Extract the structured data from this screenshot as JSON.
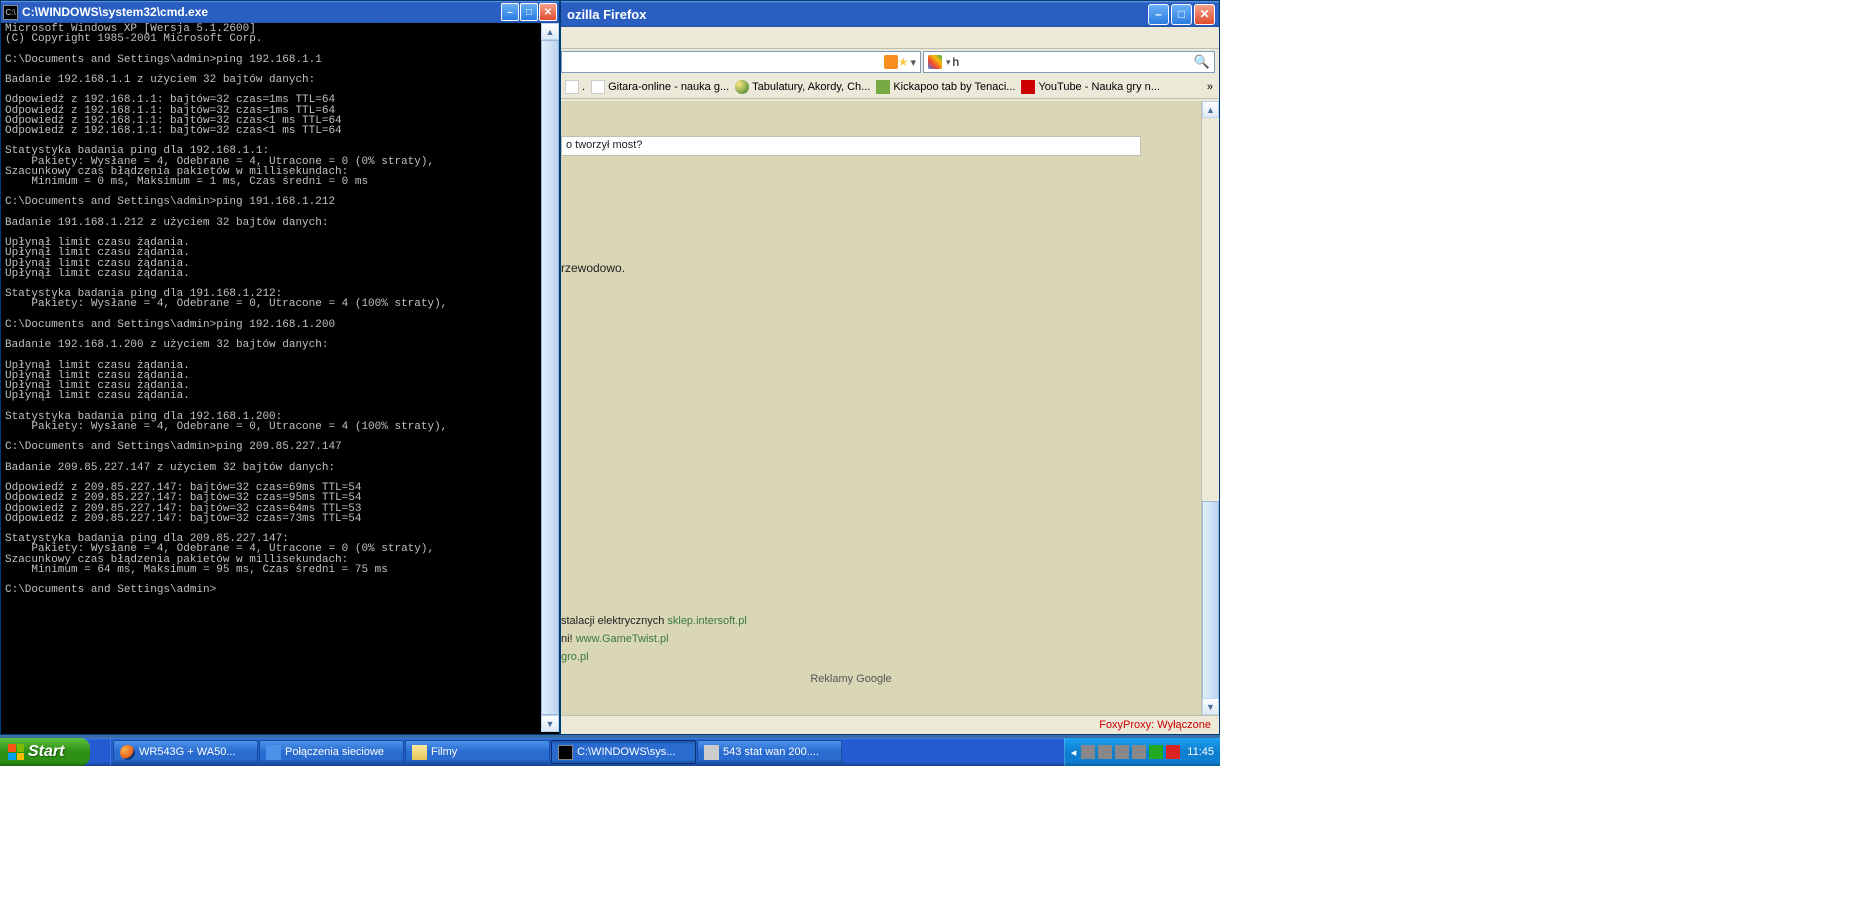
{
  "firefox": {
    "title": "ozilla Firefox",
    "search_value": "h",
    "bookmarks": [
      {
        "label": ".",
        "icon": "page"
      },
      {
        "label": "Gitara-online - nauka g...",
        "icon": "page"
      },
      {
        "label": "Tabulatury, Akordy, Ch...",
        "icon": "ball"
      },
      {
        "label": "Kickapoo tab by Tenaci...",
        "icon": "gt"
      },
      {
        "label": "YouTube - Nauka gry n...",
        "icon": "yt"
      }
    ],
    "page": {
      "question": "o tworzył most?",
      "bodyline": "rzewodowo.",
      "ads": [
        {
          "text": "stalacji elektrycznych ",
          "link": "sklep.intersoft.pl"
        },
        {
          "text": "ni! ",
          "link": "www.GameTwist.pl"
        },
        {
          "text": "",
          "link": "gro.pl"
        }
      ],
      "ads_label": "Reklamy Google"
    },
    "status": "FoxyProxy: Wyłączone"
  },
  "cmd": {
    "title": "C:\\WINDOWS\\system32\\cmd.exe",
    "lines": [
      "Microsoft Windows XP [Wersja 5.1.2600]",
      "(C) Copyright 1985-2001 Microsoft Corp.",
      "",
      "C:\\Documents and Settings\\admin>ping 192.168.1.1",
      "",
      "Badanie 192.168.1.1 z użyciem 32 bajtów danych:",
      "",
      "Odpowiedź z 192.168.1.1: bajtów=32 czas=1ms TTL=64",
      "Odpowiedź z 192.168.1.1: bajtów=32 czas=1ms TTL=64",
      "Odpowiedź z 192.168.1.1: bajtów=32 czas<1 ms TTL=64",
      "Odpowiedź z 192.168.1.1: bajtów=32 czas<1 ms TTL=64",
      "",
      "Statystyka badania ping dla 192.168.1.1:",
      "    Pakiety: Wysłane = 4, Odebrane = 4, Utracone = 0 (0% straty),",
      "Szacunkowy czas błądzenia pakietów w millisekundach:",
      "    Minimum = 0 ms, Maksimum = 1 ms, Czas średni = 0 ms",
      "",
      "C:\\Documents and Settings\\admin>ping 191.168.1.212",
      "",
      "Badanie 191.168.1.212 z użyciem 32 bajtów danych:",
      "",
      "Upłynął limit czasu żądania.",
      "Upłynął limit czasu żądania.",
      "Upłynął limit czasu żądania.",
      "Upłynął limit czasu żądania.",
      "",
      "Statystyka badania ping dla 191.168.1.212:",
      "    Pakiety: Wysłane = 4, Odebrane = 0, Utracone = 4 (100% straty),",
      "",
      "C:\\Documents and Settings\\admin>ping 192.168.1.200",
      "",
      "Badanie 192.168.1.200 z użyciem 32 bajtów danych:",
      "",
      "Upłynął limit czasu żądania.",
      "Upłynął limit czasu żądania.",
      "Upłynął limit czasu żądania.",
      "Upłynął limit czasu żądania.",
      "",
      "Statystyka badania ping dla 192.168.1.200:",
      "    Pakiety: Wysłane = 4, Odebrane = 0, Utracone = 4 (100% straty),",
      "",
      "C:\\Documents and Settings\\admin>ping 209.85.227.147",
      "",
      "Badanie 209.85.227.147 z użyciem 32 bajtów danych:",
      "",
      "Odpowiedź z 209.85.227.147: bajtów=32 czas=69ms TTL=54",
      "Odpowiedź z 209.85.227.147: bajtów=32 czas=95ms TTL=54",
      "Odpowiedź z 209.85.227.147: bajtów=32 czas=64ms TTL=53",
      "Odpowiedź z 209.85.227.147: bajtów=32 czas=73ms TTL=54",
      "",
      "Statystyka badania ping dla 209.85.227.147:",
      "    Pakiety: Wysłane = 4, Odebrane = 4, Utracone = 0 (0% straty),",
      "Szacunkowy czas błądzenia pakietów w millisekundach:",
      "    Minimum = 64 ms, Maksimum = 95 ms, Czas średni = 75 ms",
      "",
      "C:\\Documents and Settings\\admin>"
    ]
  },
  "taskbar": {
    "start": "Start",
    "tasks": [
      {
        "label": "WR543G + WA50...",
        "icon": "ff"
      },
      {
        "label": "Połączenia sieciowe",
        "icon": "net"
      },
      {
        "label": "Filmy",
        "icon": "folder"
      },
      {
        "label": "C:\\WINDOWS\\sys...",
        "icon": "cmd",
        "active": true
      },
      {
        "label": "543 stat wan 200....",
        "icon": "gen"
      }
    ],
    "clock": "11:45"
  }
}
